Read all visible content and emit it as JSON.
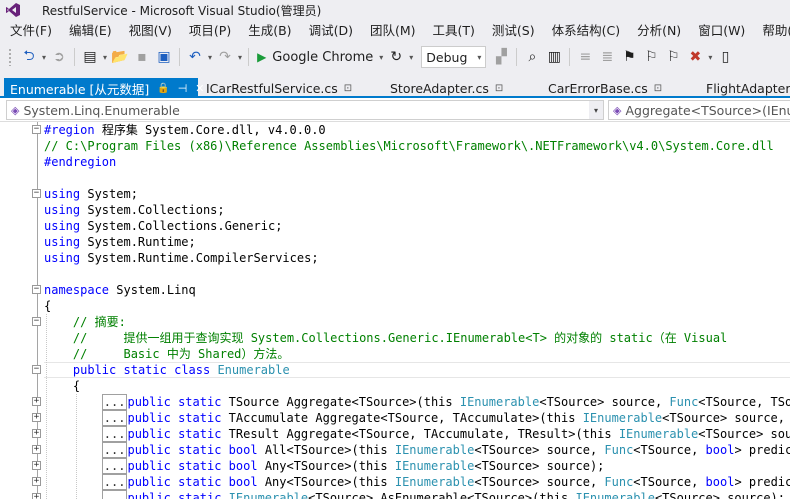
{
  "window": {
    "title": "RestfulService - Microsoft Visual Studio(管理员)"
  },
  "menu": [
    "文件(F)",
    "编辑(E)",
    "视图(V)",
    "项目(P)",
    "生成(B)",
    "调试(D)",
    "团队(M)",
    "工具(T)",
    "测试(S)",
    "体系结构(C)",
    "分析(N)",
    "窗口(W)",
    "帮助(H)"
  ],
  "toolbar": {
    "run_label": "Google Chrome",
    "config_value": "Debug"
  },
  "tabs": [
    {
      "label": "Enumerable [从元数据]",
      "active": true
    },
    {
      "label": "ICarRestfulService.cs",
      "active": false
    },
    {
      "label": "StoreAdapter.cs",
      "active": false
    },
    {
      "label": "CarErrorBase.cs",
      "active": false
    },
    {
      "label": "FlightAdapter.cs",
      "active": false
    }
  ],
  "navbar": {
    "left": "System.Linq.Enumerable",
    "right": "Aggregate<TSource>(IEnumerable<"
  },
  "code": {
    "l1": "程序集 System.Core.dll, v4.0.0.0",
    "l2": "// C:\\Program Files (x86)\\Reference Assemblies\\Microsoft\\Framework\\.NETFramework\\v4.0\\System.Core.dll",
    "l3": "#endregion",
    "using1": "System;",
    "using2": "System.Collections;",
    "using3": "System.Collections.Generic;",
    "using4": "System.Runtime;",
    "using5": "System.Runtime.CompilerServices;",
    "ns": "System.Linq",
    "c1": "// 摘要:",
    "c2": "//     提供一组用于查询实现 System.Collections.Generic.IEnumerable<T> 的对象的 static（在 Visual",
    "c3": "//     Basic 中为 Shared）方法。",
    "cls": "Enumerable",
    "m1": "TSource Aggregate<TSource>(this ",
    "m1b": "<TSource> source, ",
    "m1c": "<TSource, TSource",
    "m2": "TAccumulate Aggregate<TSource, TAccumulate>(this ",
    "m2b": "<TSource> source, TAcc",
    "m3": "TResult Aggregate<TSource, TAccumulate, TResult>(this ",
    "m3b": "<TSource> source,",
    "m4": "All<TSource>(this ",
    "m4b": "<TSource> source, ",
    "m4c": "<TSource, ",
    "m4d": "> predicate)",
    "m5": "Any<TSource>(this ",
    "m5b": "<TSource> source);",
    "m6": "Any<TSource>(this ",
    "m6b": "<TSource> source, ",
    "m6c": "<TSource, ",
    "m6d": "> predicate)",
    "m7": "<TSource> AsEnumerable<TSource>(this ",
    "m7b": "<TSource> source);"
  },
  "keywords": {
    "region": "#region",
    "using": "using",
    "namespace": "namespace",
    "public": "public",
    "static": "static",
    "class": "class",
    "bool": "bool",
    "this": "this"
  },
  "types": {
    "ienum": "IEnumerable",
    "func": "Func"
  },
  "colors": {
    "accent": "#007acc",
    "keyword": "#0000ff",
    "comment": "#008000",
    "type": "#2b91af"
  }
}
